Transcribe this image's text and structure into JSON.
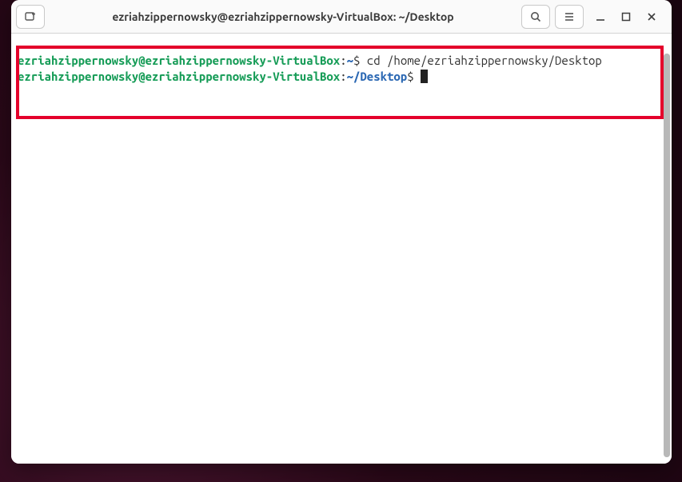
{
  "window": {
    "title": "ezriahzippernowsky@ezriahzippernowsky-VirtualBox: ~/Desktop"
  },
  "terminal": {
    "line1_user": "ezriahzippernowsky@ezriahzippernowsky-VirtualBox",
    "line1_colon": ":",
    "line1_path": "~",
    "line1_dollar": "$ ",
    "line1_cmd": "cd /home/ezriahzippernowsky/Desktop",
    "line2_user": "ezriahzippernowsky@ezriahzippernowsky-VirtualBox",
    "line2_colon": ":",
    "line2_path": "~/Desktop",
    "line2_dollar": "$ "
  },
  "colors": {
    "highlight": "#e4002b",
    "prompt_user": "#169c57",
    "prompt_path": "#2a67b3"
  }
}
